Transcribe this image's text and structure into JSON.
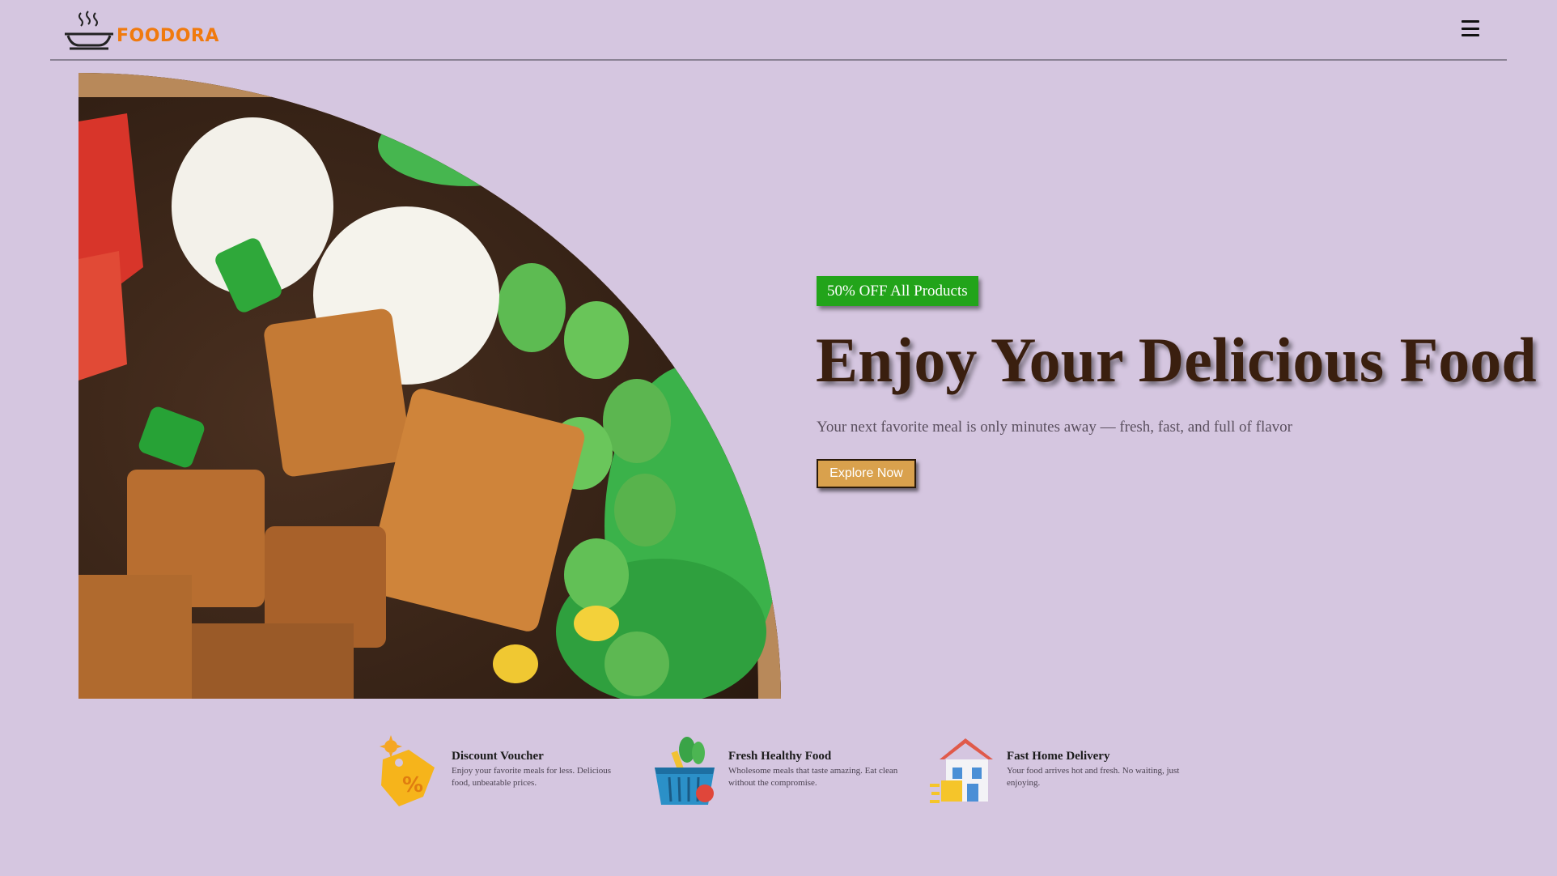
{
  "brand": {
    "name": "FOODORA",
    "color": "#f07a0e",
    "logo_icon": "steaming-pot-icon"
  },
  "header": {
    "menu_icon": "hamburger-menu-icon"
  },
  "hero": {
    "image": "salad-bowl-photo",
    "badge": "50% OFF All Products",
    "title": "Enjoy Your Delicious Food",
    "subtitle": "Your next favorite meal is only minutes away — fresh, fast, and full of flavor",
    "cta": "Explore Now"
  },
  "features": [
    {
      "icon": "discount-tag-icon",
      "title": "Discount Voucher",
      "desc": "Enjoy your favorite meals for less. Delicious food, unbeatable prices."
    },
    {
      "icon": "grocery-basket-icon",
      "title": "Fresh Healthy Food",
      "desc": "Wholesome meals that taste amazing. Eat clean without the compromise."
    },
    {
      "icon": "delivery-house-icon",
      "title": "Fast Home Delivery",
      "desc": "Your food arrives hot and fresh. No waiting, just enjoying."
    }
  ],
  "colors": {
    "background": "#d5c6e0",
    "badge": "#22a41a",
    "title": "#3a1f0f",
    "button": "#d9a14d"
  }
}
